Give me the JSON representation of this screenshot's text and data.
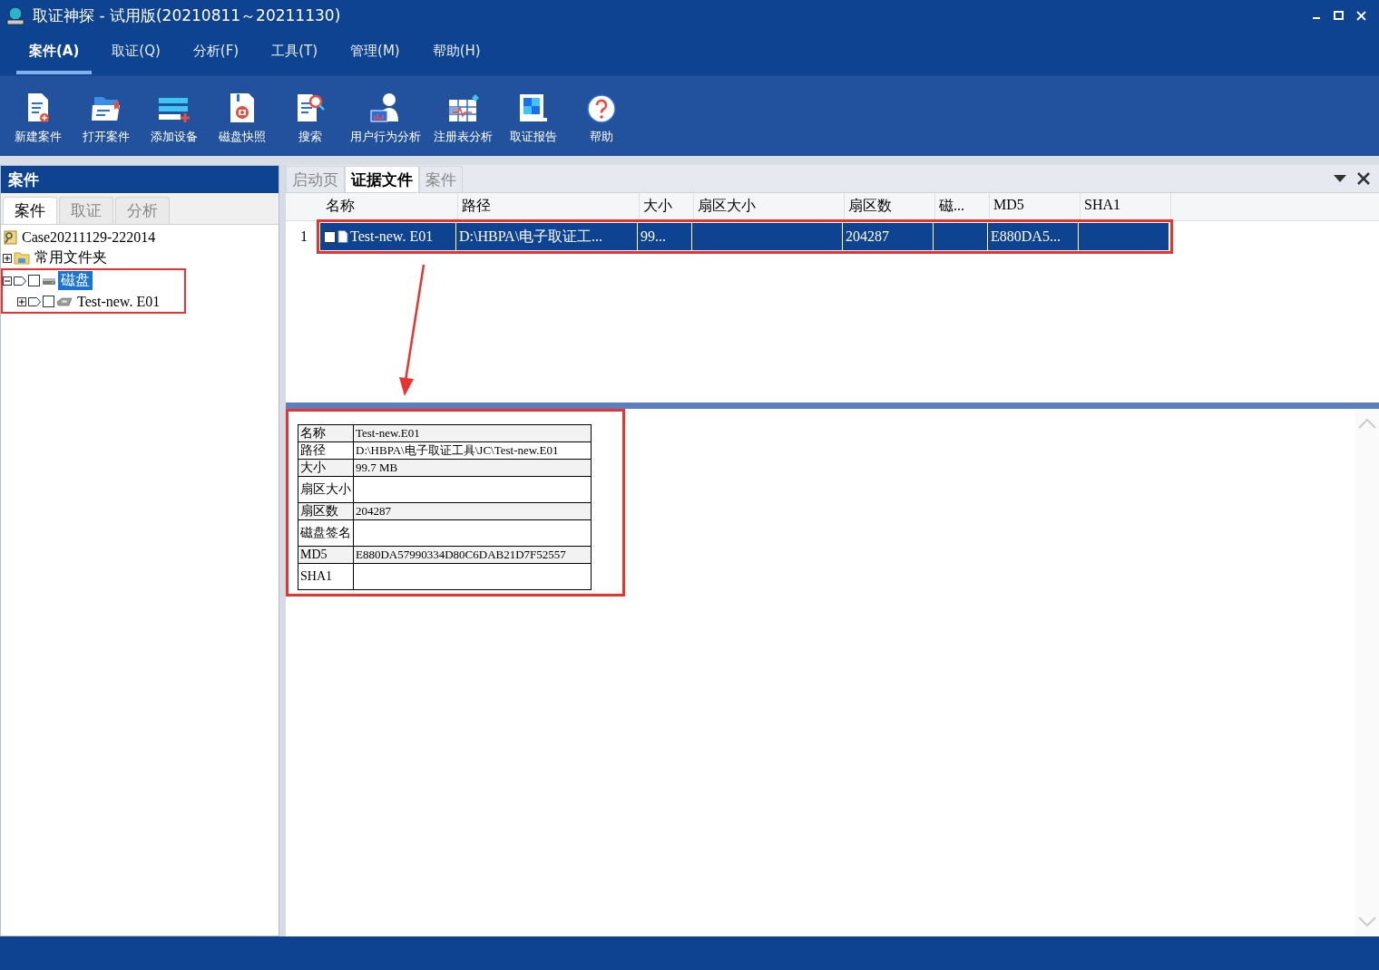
{
  "window": {
    "title": "取证神探 - 试用版(20210811～20211130)"
  },
  "menu": [
    {
      "label": "案件(A)",
      "selected": true
    },
    {
      "label": "取证(Q)",
      "selected": false
    },
    {
      "label": "分析(F)",
      "selected": false
    },
    {
      "label": "工具(T)",
      "selected": false
    },
    {
      "label": "管理(M)",
      "selected": false
    },
    {
      "label": "帮助(H)",
      "selected": false
    }
  ],
  "toolbar": [
    {
      "label": "新建案件",
      "kind": "new-case"
    },
    {
      "label": "打开案件",
      "kind": "open-case"
    },
    {
      "label": "添加设备",
      "kind": "add-device"
    },
    {
      "label": "磁盘快照",
      "kind": "snapshot"
    },
    {
      "label": "搜索",
      "kind": "search"
    },
    {
      "label": "用户行为分析",
      "kind": "user"
    },
    {
      "label": "注册表分析",
      "kind": "registry"
    },
    {
      "label": "取证报告",
      "kind": "report"
    },
    {
      "label": "帮助",
      "kind": "help"
    }
  ],
  "left_panel": {
    "title": "案件",
    "tabs": [
      {
        "label": "案件",
        "selected": true
      },
      {
        "label": "取证",
        "selected": false
      },
      {
        "label": "分析",
        "selected": false
      }
    ],
    "tree": [
      {
        "label": "Case20211129-222014",
        "kind": "case",
        "selected": false,
        "highlighted": false
      },
      {
        "label": "常用文件夹",
        "kind": "folder",
        "expanded": false,
        "selected": false,
        "highlighted": false
      },
      {
        "label": "磁盘",
        "kind": "disk",
        "expanded": true,
        "checked": false,
        "selected": true,
        "highlighted": true,
        "children": [
          {
            "label": "Test-new. E01",
            "kind": "image",
            "expanded": false,
            "checked": false,
            "selected": false,
            "highlighted": false
          }
        ]
      }
    ]
  },
  "right_panel": {
    "tabs": [
      {
        "label": "启动页",
        "selected": false
      },
      {
        "label": "证据文件",
        "selected": true
      },
      {
        "label": "案件",
        "selected": false
      }
    ],
    "grid": {
      "columns": [
        "名称",
        "路径",
        "大小",
        "扇区大小",
        "扇区数",
        "磁...",
        "MD5",
        "SHA1"
      ],
      "rows": [
        {
          "number": "1",
          "checked": false,
          "selected": true,
          "highlighted": true,
          "cells": [
            "Test-new. E01",
            "D:\\HBPA\\电子取证工...",
            "99...",
            null,
            "204287",
            null,
            "E880DA5...",
            null
          ]
        }
      ]
    },
    "details": [
      {
        "label": "名称",
        "value": "Test-new.E01"
      },
      {
        "label": "路径",
        "value": "D:\\HBPA\\电子取证工具\\JC\\Test-new.E01"
      },
      {
        "label": "大小",
        "value": "99.7 MB"
      },
      {
        "label": "扇区大小"
      },
      {
        "label": "扇区数",
        "value": "204287"
      },
      {
        "label": "磁盘签名"
      },
      {
        "label": "MD5",
        "value": "E880DA57990334D80C6DAB21D7F52557"
      },
      {
        "label": "SHA1"
      }
    ]
  }
}
